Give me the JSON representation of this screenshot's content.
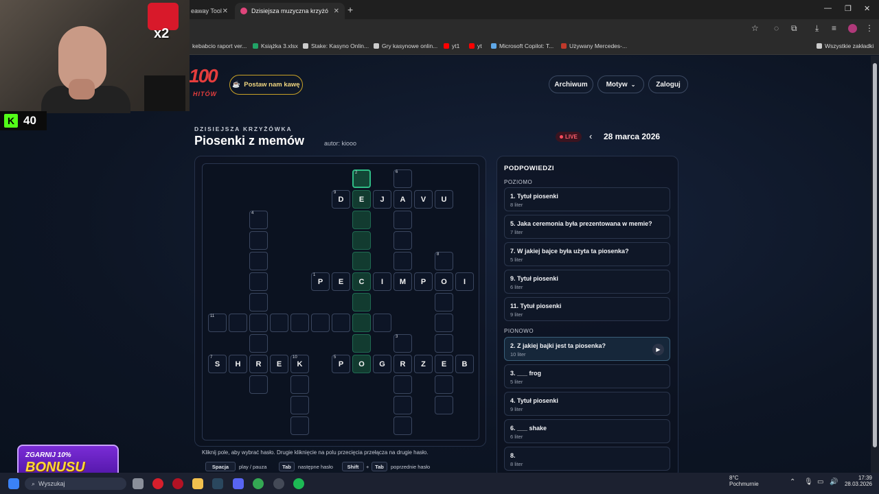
{
  "browser": {
    "tabs": [
      {
        "label": "eaway Tool"
      },
      {
        "label": "Dzisiejsza muzyczna krzyżówka"
      }
    ],
    "bookmarks": [
      {
        "label": "kebabcio raport ver...",
        "icon": "doc-icon",
        "color": "#4a8cf7"
      },
      {
        "label": "Książka 3.xlsx",
        "icon": "sheet-icon",
        "color": "#21a366"
      },
      {
        "label": "Stake: Kasyno Onlin...",
        "icon": "stake-icon",
        "color": "#cccccc"
      },
      {
        "label": "Gry kasynowe onlin...",
        "icon": "stake-icon",
        "color": "#cccccc"
      },
      {
        "label": "yt1",
        "icon": "youtube-icon",
        "color": "#ff0000"
      },
      {
        "label": "yt",
        "icon": "youtube-icon",
        "color": "#ff0000"
      },
      {
        "label": "Microsoft Copilot: T...",
        "icon": "copilot-icon",
        "color": "#5fa8e8"
      },
      {
        "label": "Używany Mercedes-...",
        "icon": "car-icon",
        "color": "#c0392b"
      },
      {
        "label": "Wszystkie zakładki",
        "icon": "folder-icon",
        "color": "#cccccc"
      }
    ]
  },
  "header": {
    "logo_top": "100",
    "logo_bottom": "HITÓW",
    "coffee_label": "Postaw nam kawę",
    "nav": {
      "archive": "Archiwum",
      "theme": "Motyw",
      "login": "Zaloguj"
    }
  },
  "puzzle": {
    "kicker": "DZISIEJSZA KRZYŻÓWKA",
    "title": "Piosenki z memów",
    "author": "autor: kiooo",
    "live": "LIVE",
    "date": "28 marca 2026"
  },
  "grid": {
    "cells": [
      {
        "r": 0,
        "c": 7,
        "n": "2",
        "l": "",
        "s": "sel"
      },
      {
        "r": 0,
        "c": 9,
        "n": "6",
        "l": "",
        "s": ""
      },
      {
        "r": 1,
        "c": 6,
        "n": "9",
        "l": "D",
        "s": ""
      },
      {
        "r": 1,
        "c": 7,
        "n": "",
        "l": "E",
        "s": "hl"
      },
      {
        "r": 1,
        "c": 8,
        "n": "",
        "l": "J",
        "s": ""
      },
      {
        "r": 1,
        "c": 9,
        "n": "",
        "l": "A",
        "s": ""
      },
      {
        "r": 1,
        "c": 10,
        "n": "",
        "l": "V",
        "s": ""
      },
      {
        "r": 1,
        "c": 11,
        "n": "",
        "l": "U",
        "s": ""
      },
      {
        "r": 2,
        "c": 2,
        "n": "4",
        "l": "",
        "s": ""
      },
      {
        "r": 2,
        "c": 7,
        "n": "",
        "l": "",
        "s": "hl"
      },
      {
        "r": 2,
        "c": 9,
        "n": "",
        "l": "",
        "s": ""
      },
      {
        "r": 3,
        "c": 2,
        "n": "",
        "l": "",
        "s": ""
      },
      {
        "r": 3,
        "c": 7,
        "n": "",
        "l": "",
        "s": "hl"
      },
      {
        "r": 3,
        "c": 9,
        "n": "",
        "l": "",
        "s": ""
      },
      {
        "r": 4,
        "c": 2,
        "n": "",
        "l": "",
        "s": ""
      },
      {
        "r": 4,
        "c": 7,
        "n": "",
        "l": "",
        "s": "hl"
      },
      {
        "r": 4,
        "c": 9,
        "n": "",
        "l": "",
        "s": ""
      },
      {
        "r": 4,
        "c": 11,
        "n": "8",
        "l": "",
        "s": ""
      },
      {
        "r": 5,
        "c": 2,
        "n": "",
        "l": "",
        "s": ""
      },
      {
        "r": 5,
        "c": 5,
        "n": "1",
        "l": "P",
        "s": ""
      },
      {
        "r": 5,
        "c": 6,
        "n": "",
        "l": "E",
        "s": ""
      },
      {
        "r": 5,
        "c": 7,
        "n": "",
        "l": "C",
        "s": "hl"
      },
      {
        "r": 5,
        "c": 8,
        "n": "",
        "l": "I",
        "s": ""
      },
      {
        "r": 5,
        "c": 9,
        "n": "",
        "l": "M",
        "s": ""
      },
      {
        "r": 5,
        "c": 10,
        "n": "",
        "l": "P",
        "s": ""
      },
      {
        "r": 5,
        "c": 11,
        "n": "",
        "l": "O",
        "s": ""
      },
      {
        "r": 5,
        "c": 12,
        "n": "",
        "l": "I",
        "s": ""
      },
      {
        "r": 6,
        "c": 2,
        "n": "",
        "l": "",
        "s": ""
      },
      {
        "r": 6,
        "c": 7,
        "n": "",
        "l": "",
        "s": "hl"
      },
      {
        "r": 6,
        "c": 11,
        "n": "",
        "l": "",
        "s": ""
      },
      {
        "r": 7,
        "c": 0,
        "n": "11",
        "l": "",
        "s": ""
      },
      {
        "r": 7,
        "c": 1,
        "n": "",
        "l": "",
        "s": ""
      },
      {
        "r": 7,
        "c": 2,
        "n": "",
        "l": "",
        "s": ""
      },
      {
        "r": 7,
        "c": 3,
        "n": "",
        "l": "",
        "s": ""
      },
      {
        "r": 7,
        "c": 4,
        "n": "",
        "l": "",
        "s": ""
      },
      {
        "r": 7,
        "c": 5,
        "n": "",
        "l": "",
        "s": ""
      },
      {
        "r": 7,
        "c": 6,
        "n": "",
        "l": "",
        "s": ""
      },
      {
        "r": 7,
        "c": 7,
        "n": "",
        "l": "",
        "s": "hl"
      },
      {
        "r": 7,
        "c": 8,
        "n": "",
        "l": "",
        "s": ""
      },
      {
        "r": 7,
        "c": 11,
        "n": "",
        "l": "",
        "s": ""
      },
      {
        "r": 8,
        "c": 2,
        "n": "",
        "l": "",
        "s": ""
      },
      {
        "r": 8,
        "c": 7,
        "n": "",
        "l": "",
        "s": "hl"
      },
      {
        "r": 8,
        "c": 9,
        "n": "3",
        "l": "",
        "s": ""
      },
      {
        "r": 8,
        "c": 11,
        "n": "",
        "l": "",
        "s": ""
      },
      {
        "r": 9,
        "c": 0,
        "n": "7",
        "l": "S",
        "s": ""
      },
      {
        "r": 9,
        "c": 1,
        "n": "",
        "l": "H",
        "s": ""
      },
      {
        "r": 9,
        "c": 2,
        "n": "",
        "l": "R",
        "s": ""
      },
      {
        "r": 9,
        "c": 3,
        "n": "",
        "l": "E",
        "s": ""
      },
      {
        "r": 9,
        "c": 4,
        "n": "10",
        "l": "K",
        "s": ""
      },
      {
        "r": 9,
        "c": 6,
        "n": "5",
        "l": "P",
        "s": ""
      },
      {
        "r": 9,
        "c": 7,
        "n": "",
        "l": "O",
        "s": "hl"
      },
      {
        "r": 9,
        "c": 8,
        "n": "",
        "l": "G",
        "s": ""
      },
      {
        "r": 9,
        "c": 9,
        "n": "",
        "l": "R",
        "s": ""
      },
      {
        "r": 9,
        "c": 10,
        "n": "",
        "l": "Z",
        "s": ""
      },
      {
        "r": 9,
        "c": 11,
        "n": "",
        "l": "E",
        "s": ""
      },
      {
        "r": 9,
        "c": 12,
        "n": "",
        "l": "B",
        "s": ""
      },
      {
        "r": 10,
        "c": 2,
        "n": "",
        "l": "",
        "s": ""
      },
      {
        "r": 10,
        "c": 4,
        "n": "",
        "l": "",
        "s": ""
      },
      {
        "r": 10,
        "c": 9,
        "n": "",
        "l": "",
        "s": ""
      },
      {
        "r": 10,
        "c": 11,
        "n": "",
        "l": "",
        "s": ""
      },
      {
        "r": 11,
        "c": 4,
        "n": "",
        "l": "",
        "s": ""
      },
      {
        "r": 11,
        "c": 9,
        "n": "",
        "l": "",
        "s": ""
      },
      {
        "r": 11,
        "c": 11,
        "n": "",
        "l": "",
        "s": ""
      },
      {
        "r": 12,
        "c": 4,
        "n": "",
        "l": "",
        "s": ""
      },
      {
        "r": 12,
        "c": 9,
        "n": "",
        "l": "",
        "s": ""
      }
    ],
    "hint": "Kliknij pole, aby wybrać hasło. Drugie kliknięcie na polu przecięcia przełącza na drugie hasło.",
    "keys": {
      "space": "Spacja",
      "space_desc": "play / pauza",
      "tab": "Tab",
      "tab_desc": "następne hasło",
      "shift": "Shift",
      "plus": "+",
      "tab2": "Tab",
      "shift_desc": "poprzednie hasło"
    }
  },
  "clues": {
    "title": "PODPOWIEDZI",
    "across_label": "POZIOMO",
    "down_label": "PIONOWO",
    "across": [
      {
        "text": "1. Tytuł piosenki",
        "len": "8 liter"
      },
      {
        "text": "5. Jaka ceremonia była prezentowana w memie?",
        "len": "7 liter"
      },
      {
        "text": "7. W jakiej bajce była użyta ta piosenka?",
        "len": "5 liter"
      },
      {
        "text": "9. Tytuł piosenki",
        "len": "6 liter"
      },
      {
        "text": "11. Tytuł piosenki",
        "len": "9 liter"
      }
    ],
    "down": [
      {
        "text": "2. Z jakiej bajki jest ta piosenka?",
        "len": "10 liter",
        "active": true
      },
      {
        "text": "3. ___ frog",
        "len": "5 liter"
      },
      {
        "text": "4. Tytuł piosenki",
        "len": "9 liter"
      },
      {
        "text": "6. ___ shake",
        "len": "6 liter"
      },
      {
        "text": "8.",
        "len": "8 liter"
      }
    ]
  },
  "overlay": {
    "multiplier": "x2",
    "viewers": "40",
    "promo_line1": "ZGARNIJ 10%",
    "promo_line2": "BONUSU"
  },
  "taskbar": {
    "search_placeholder": "Wyszukaj",
    "weather_temp": "8°C",
    "weather_desc": "Pochmurnie",
    "time": "17:39",
    "date": "28.03.2026"
  }
}
